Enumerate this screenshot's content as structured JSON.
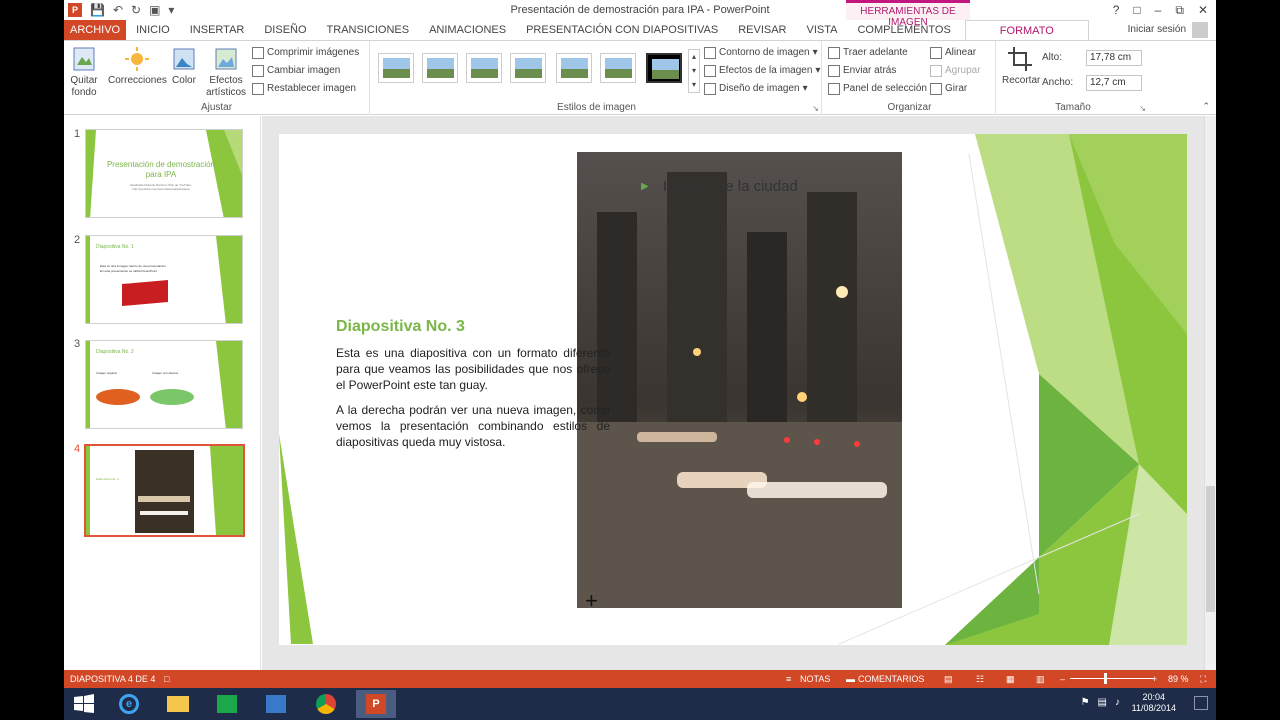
{
  "window": {
    "title": "Presentación de demostración para IPA - PowerPoint",
    "contextual_group": "HERRAMIENTAS DE IMAGEN",
    "help": "?",
    "signin": "Iniciar sesión"
  },
  "tabs": [
    "ARCHIVO",
    "INICIO",
    "INSERTAR",
    "DISEÑO",
    "TRANSICIONES",
    "ANIMACIONES",
    "PRESENTACIÓN CON DIAPOSITIVAS",
    "REVISAR",
    "VISTA",
    "COMPLEMENTOS",
    "FORMATO"
  ],
  "ribbon": {
    "ajustar": {
      "label": "Ajustar",
      "quitar_fondo": "Quitar fondo",
      "correcciones": "Correcciones",
      "color": "Color",
      "efectos": "Efectos artísticos",
      "comprimir": "Comprimir imágenes",
      "cambiar": "Cambiar imagen",
      "restablecer": "Restablecer imagen"
    },
    "estilos": {
      "label": "Estilos de imagen",
      "contorno": "Contorno de imagen",
      "efectos": "Efectos de la imagen",
      "diseno": "Diseño de imagen"
    },
    "organizar": {
      "label": "Organizar",
      "traer": "Traer adelante",
      "enviar": "Enviar atrás",
      "panel": "Panel de selección",
      "alinear": "Alinear",
      "agrupar": "Agrupar",
      "girar": "Girar"
    },
    "tamano": {
      "label": "Tamaño",
      "recortar": "Recortar",
      "alto_label": "Alto:",
      "alto_value": "17,78 cm",
      "ancho_label": "Ancho:",
      "ancho_value": "12,7 cm"
    }
  },
  "thumbnails": [
    {
      "num": "1",
      "title": "Presentación de demostración para IPA",
      "subtitle": "Realizado Roberto Ramírez Sitio de YouTube: http://youtube.com/user/sistemasipa/videos"
    },
    {
      "num": "2",
      "title": "Diapositiva No. 1",
      "bullets": [
        "Esta es otra inmagen dentro de una presentación",
        "En esta presentación se utiliza PowerPoint"
      ]
    },
    {
      "num": "3",
      "title": "Diapositiva No. 2",
      "left_label": "Imagen original",
      "right_label": "Imagen con efectos"
    },
    {
      "num": "4",
      "title": "Diapositiva No. 3"
    }
  ],
  "slide": {
    "bullet": "Imagen de la ciudad",
    "title": "Diapositiva No. 3",
    "para1": "Esta es una diapositiva con un formato diferente para que veamos las posibilidades que nos ofrece el PowerPoint este tan guay.",
    "para2": "A la derecha podrán ver una nueva imagen, como vemos la presentación combinando estilos de diapositivas queda muy vistosa."
  },
  "statusbar": {
    "slide_info": "DIAPOSITIVA 4 DE 4",
    "notas": "NOTAS",
    "comentarios": "COMENTARIOS",
    "zoom": "89 %"
  },
  "taskbar": {
    "time": "20:04",
    "date": "11/08/2014"
  },
  "colors": {
    "accent": "#d24726",
    "contextual": "#b2186d",
    "slide_green": "#8cc63f",
    "title_green": "#7ab648"
  }
}
